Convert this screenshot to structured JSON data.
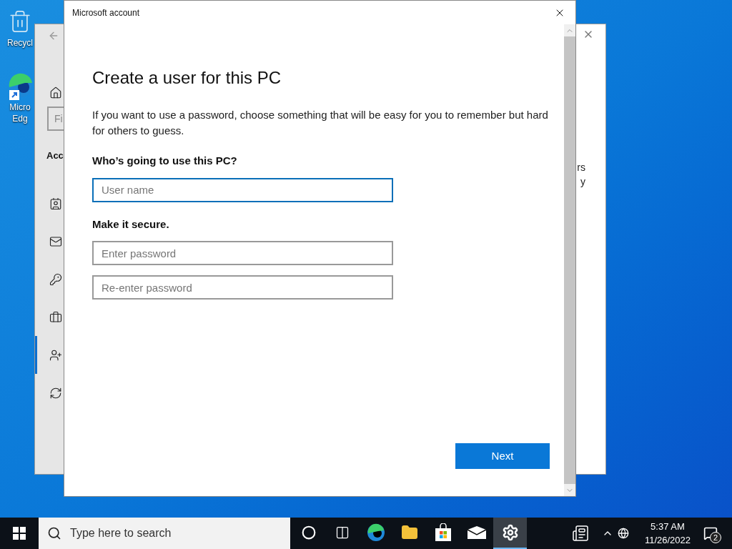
{
  "desktop_icons": [
    {
      "kind": "recycle",
      "lines": [
        "Recycl"
      ]
    },
    {
      "kind": "edge",
      "lines": [
        "Micro",
        "Edg"
      ]
    }
  ],
  "settings_window": {
    "search_text": "Fi",
    "heading": "Acc",
    "nav_items": [
      {
        "kind": "home",
        "selected": false
      },
      {
        "kind": "info",
        "selected": false
      },
      {
        "kind": "mail",
        "selected": false
      },
      {
        "kind": "key",
        "selected": false
      },
      {
        "kind": "work",
        "selected": false
      },
      {
        "kind": "family",
        "selected": true
      },
      {
        "kind": "sync",
        "selected": false
      }
    ],
    "right_fragments": [
      "rs",
      "y"
    ]
  },
  "dialog": {
    "title": "Microsoft account",
    "heading": "Create a user for this PC",
    "description": "If you want to use a password, choose something that will be easy for you to remember but hard for others to guess.",
    "sections": [
      {
        "label": "Who’s going to use this PC?",
        "fields": [
          {
            "placeholder": "User name",
            "focused": true
          }
        ]
      },
      {
        "label": "Make it secure.",
        "fields": [
          {
            "placeholder": "Enter password",
            "focused": false
          },
          {
            "placeholder": "Re-enter password",
            "focused": false
          }
        ]
      }
    ],
    "next_button": "Next"
  },
  "taskbar": {
    "search_placeholder": "Type here to search",
    "apps": [
      {
        "kind": "cortana",
        "selected": false
      },
      {
        "kind": "taskview",
        "selected": false
      },
      {
        "kind": "edge",
        "selected": false
      },
      {
        "kind": "explorer",
        "selected": false
      },
      {
        "kind": "store",
        "selected": false
      },
      {
        "kind": "mail",
        "selected": false
      },
      {
        "kind": "settings",
        "selected": true
      }
    ],
    "time": "5:37 AM",
    "date": "11/26/2022",
    "notification_count": "2"
  }
}
